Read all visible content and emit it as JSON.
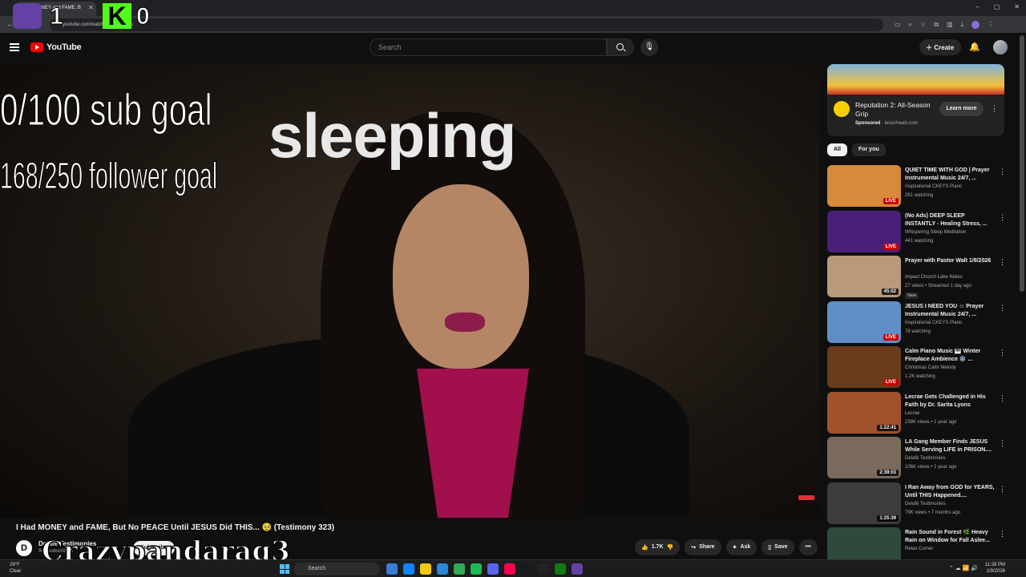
{
  "browser": {
    "tab_title": "I Had MONEY and FAME, B",
    "url": "youtube.com/watch?v=...beyTfxo"
  },
  "overlay": {
    "twitch_count": "1",
    "kick_logo": "K",
    "kick_count": "0",
    "sub_goal": "0/100 sub goal",
    "follower_goal": "168/250 follower goal",
    "status": "sleeping",
    "streamer_name": "Crazypandarag3"
  },
  "header": {
    "logo_text": "YouTube",
    "search_placeholder": "Search",
    "create_label": "Create"
  },
  "video": {
    "title": "I Had MONEY and FAME, But No PEACE Until JESUS Did THIS... 🥹 (Testimony 323)",
    "channel": "Delafé Testimonies",
    "subscribers": "94K subscribers",
    "subscribe_label": "Subscribe",
    "likes": "1.7K",
    "share_label": "Share",
    "ask_label": "Ask",
    "save_label": "Save"
  },
  "ad": {
    "title": "Reputation 2: All-Season Grip",
    "sponsored": "Sponsored",
    "domain": "lesschwab.com",
    "cta": "Learn more"
  },
  "chips": [
    "All",
    "For you"
  ],
  "recommendations": [
    {
      "title": "QUIET TIME WITH GOD | Prayer Instrumental Music 24/7, ...",
      "channel": "Inspirational CKEYS Piano",
      "meta": "261 watching",
      "badge": "LIVE",
      "live": true,
      "color": "#d68a3a"
    },
    {
      "title": "(No Ads) DEEP SLEEP INSTANTLY - Healing Stress, ...",
      "channel": "Whispering Sleep Meditation",
      "meta": "441 watching",
      "badge": "LIVE",
      "live": true,
      "color": "#4a1f7a"
    },
    {
      "title": "Prayer with Pastor Walt 1/8/2026",
      "channel": "Impact Church Lake Wales",
      "meta": "27 views • Streamed 1 day ago",
      "badge": "45:02",
      "live": false,
      "isnew": "New",
      "color": "#b89a7a"
    },
    {
      "title": "JESUS I NEED YOU ☺ Prayer Instrumental Music 24/7, ...",
      "channel": "Inspirational CKEYS Piano",
      "meta": "78 watching",
      "badge": "LIVE",
      "live": true,
      "color": "#5f8fc4"
    },
    {
      "title": "Calm Piano Music 🎹 Winter Fireplace Ambience ❄️ ...",
      "channel": "Christmas Calm Melody",
      "meta": "1.2K watching",
      "badge": "LIVE",
      "live": true,
      "color": "#6a3b1c"
    },
    {
      "title": "Lecrae Gets Challenged in His Faith by Dr. Sarita Lyons",
      "channel": "Lecrae",
      "meta": "238K views • 1 year ago",
      "badge": "1:22:41",
      "live": false,
      "color": "#a0522d"
    },
    {
      "title": "LA Gang Member Finds JESUS While Serving LIFE in PRISON....",
      "channel": "Delafé Testimonies",
      "meta": "106K views • 1 year ago",
      "badge": "2:39:03",
      "live": false,
      "color": "#7a6a5c"
    },
    {
      "title": "I Ran Away from GOD for YEARS, Until THIS Happened....",
      "channel": "Delafé Testimonies",
      "meta": "79K views • 7 months ago",
      "badge": "1:25:39",
      "live": false,
      "color": "#3c3c3c"
    },
    {
      "title": "Rain Sound in Forest 🌿 Heavy Rain on Window for Fall Aslee...",
      "channel": "Relax Corner",
      "meta": "",
      "badge": "",
      "live": false,
      "color": "#2e4a3a"
    }
  ],
  "taskbar": {
    "temp": "29°F",
    "weather": "Clear",
    "search_label": "Search",
    "time": "11:28 PM",
    "date": "1/9/2026"
  }
}
